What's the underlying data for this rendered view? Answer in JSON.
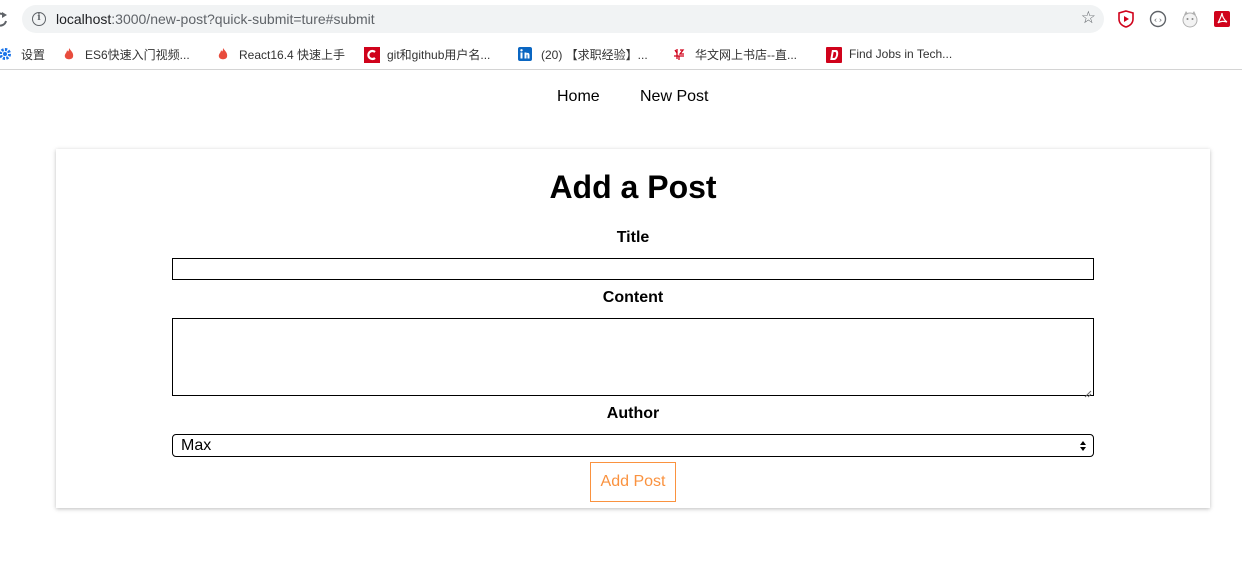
{
  "browser": {
    "url_host": "localhost",
    "url_rest": ":3000/new-post?quick-submit=ture#submit",
    "bookmarks": [
      {
        "label": "设置",
        "icon": "gear-icon",
        "color": "#1a73e8"
      },
      {
        "label": "ES6快速入门视频...",
        "icon": "flame-icon",
        "color": "#e84c3d"
      },
      {
        "label": "React16.4 快速上手",
        "icon": "flame-icon",
        "color": "#e84c3d"
      },
      {
        "label": "git和github用户名...",
        "icon": "c-logo-icon",
        "color": "#d0021b"
      },
      {
        "label": "(20) 【求职经验】...",
        "icon": "linkedin-icon",
        "color": "#0a66c2"
      },
      {
        "label": "华文网上书店--直...",
        "icon": "hua-logo-icon",
        "color": "#d0021b"
      },
      {
        "label": "Find Jobs in Tech...",
        "icon": "dice-logo-icon",
        "color": "#d0021b"
      }
    ]
  },
  "nav": {
    "home_label": "Home",
    "new_post_label": "New Post"
  },
  "form": {
    "heading": "Add a Post",
    "title_label": "Title",
    "title_value": "",
    "content_label": "Content",
    "content_value": "",
    "author_label": "Author",
    "author_selected": "Max",
    "submit_label": "Add Post",
    "accent_color": "#fa923f"
  }
}
